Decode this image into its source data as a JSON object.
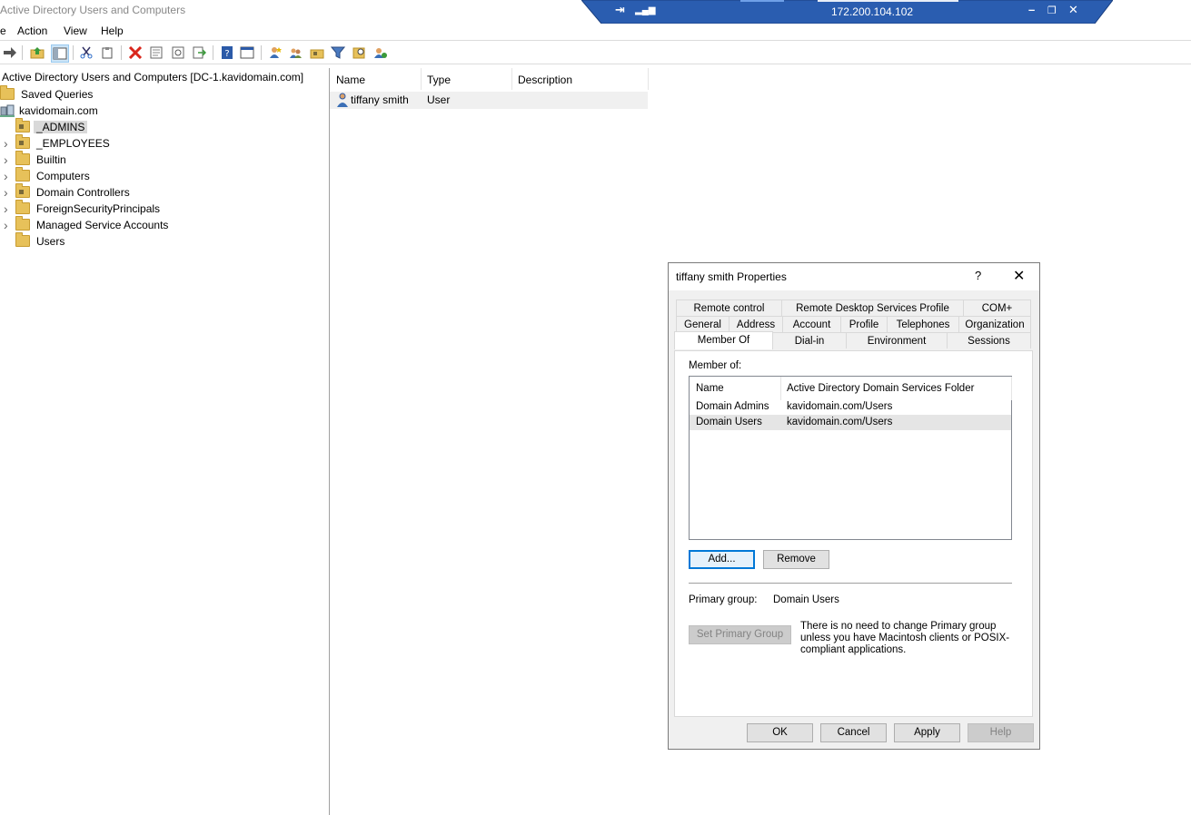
{
  "window": {
    "title": "Active Directory Users and Computers"
  },
  "rdp": {
    "address": "172.200.104.102"
  },
  "menu": [
    "e",
    "Action",
    "View",
    "Help"
  ],
  "toolbar": {
    "icons": [
      "forward-arrow-icon",
      "up-folder-icon",
      "show-tree-icon",
      "cut-icon",
      "paste-icon",
      "delete-icon",
      "properties-icon",
      "refresh-icon",
      "export-list-icon",
      "help-icon",
      "console-view-icon",
      "new-user-icon",
      "new-group-icon",
      "new-ou-icon",
      "filter-icon",
      "find-icon",
      "add-to-group-icon"
    ]
  },
  "tree": {
    "root": "Active Directory Users and Computers [DC-1.kavidomain.com]",
    "saved_queries": "Saved Queries",
    "domain": "kavidomain.com",
    "nodes": [
      {
        "label": "_ADMINS",
        "selected": true,
        "expandable": false,
        "ou": true
      },
      {
        "label": "_EMPLOYEES",
        "selected": false,
        "expandable": true,
        "ou": true
      },
      {
        "label": "Builtin",
        "selected": false,
        "expandable": true,
        "ou": false
      },
      {
        "label": "Computers",
        "selected": false,
        "expandable": true,
        "ou": false
      },
      {
        "label": "Domain Controllers",
        "selected": false,
        "expandable": true,
        "ou": true
      },
      {
        "label": "ForeignSecurityPrincipals",
        "selected": false,
        "expandable": true,
        "ou": false
      },
      {
        "label": "Managed Service Accounts",
        "selected": false,
        "expandable": true,
        "ou": false
      },
      {
        "label": "Users",
        "selected": false,
        "expandable": false,
        "ou": false
      }
    ]
  },
  "list": {
    "columns": [
      "Name",
      "Type",
      "Description"
    ],
    "rows": [
      {
        "name": "tiffany smith",
        "type": "User",
        "description": ""
      }
    ]
  },
  "dialog": {
    "title": "tiffany smith Properties",
    "help": "?",
    "close": "✕",
    "tabs_row1": [
      "Remote control",
      "Remote Desktop Services Profile",
      "COM+"
    ],
    "tabs_row2": [
      "General",
      "Address",
      "Account",
      "Profile",
      "Telephones",
      "Organization"
    ],
    "tabs_row3": [
      "Member Of",
      "Dial-in",
      "Environment",
      "Sessions"
    ],
    "active_tab": "Member Of",
    "member_of_label": "Member of:",
    "columns": [
      "Name",
      "Active Directory Domain Services Folder"
    ],
    "groups": [
      {
        "name": "Domain Admins",
        "folder": "kavidomain.com/Users"
      },
      {
        "name": "Domain Users",
        "folder": "kavidomain.com/Users"
      }
    ],
    "add_label": "Add...",
    "remove_label": "Remove",
    "primary_group_label": "Primary group:",
    "primary_group_value": "Domain Users",
    "set_primary_label": "Set Primary Group",
    "note": "There is no need to change Primary group unless you have Macintosh clients or POSIX-compliant applications.",
    "ok_label": "OK",
    "cancel_label": "Cancel",
    "apply_label": "Apply",
    "help_label": "Help"
  }
}
